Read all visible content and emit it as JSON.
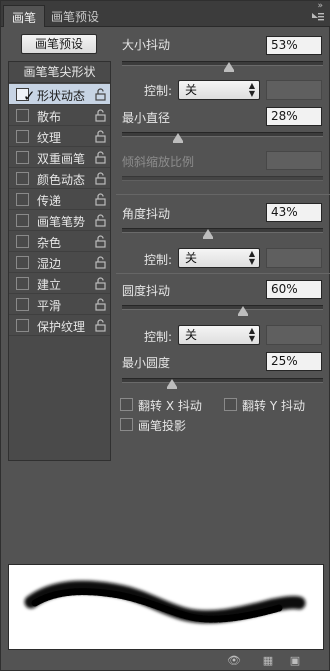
{
  "tabs": [
    {
      "label": "画笔"
    },
    {
      "label": "画笔预设"
    }
  ],
  "preset_button": "画笔预设",
  "list": {
    "header": "画笔笔尖形状",
    "items": [
      {
        "label": "形状动态",
        "checked": true,
        "selected": true
      },
      {
        "label": "散布",
        "checked": false,
        "selected": false
      },
      {
        "label": "纹理",
        "checked": false,
        "selected": false
      },
      {
        "label": "双重画笔",
        "checked": false,
        "selected": false
      },
      {
        "label": "颜色动态",
        "checked": false,
        "selected": false
      },
      {
        "label": "传递",
        "checked": false,
        "selected": false
      },
      {
        "label": "画笔笔势",
        "checked": false,
        "selected": false
      },
      {
        "label": "杂色",
        "checked": false,
        "selected": false
      },
      {
        "label": "湿边",
        "checked": false,
        "selected": false
      },
      {
        "label": "建立",
        "checked": false,
        "selected": false
      },
      {
        "label": "平滑",
        "checked": false,
        "selected": false
      },
      {
        "label": "保护纹理",
        "checked": false,
        "selected": false
      }
    ]
  },
  "settings": {
    "size_jitter": {
      "label": "大小抖动",
      "value": "53%",
      "level": 0.53
    },
    "size_control": {
      "label": "控制:",
      "selected": "关"
    },
    "min_diameter": {
      "label": "最小直径",
      "value": "28%",
      "level": 0.28
    },
    "tilt_scale": {
      "label": "倾斜缩放比例"
    },
    "angle_jitter": {
      "label": "角度抖动",
      "value": "43%",
      "level": 0.43
    },
    "angle_control": {
      "label": "控制:",
      "selected": "关"
    },
    "roundness_jitter": {
      "label": "圆度抖动",
      "value": "60%",
      "level": 0.6
    },
    "roundness_control": {
      "label": "控制:",
      "selected": "关"
    },
    "min_roundness": {
      "label": "最小圆度",
      "value": "25%",
      "level": 0.25
    },
    "flip_x": {
      "label": "翻转 X 抖动",
      "checked": false
    },
    "flip_y": {
      "label": "翻转 Y 抖动",
      "checked": false
    },
    "brush_projection": {
      "label": "画笔投影",
      "checked": false
    }
  },
  "colors": {
    "panel_bg": "#535353",
    "selected_row": "#c7d4e4"
  }
}
